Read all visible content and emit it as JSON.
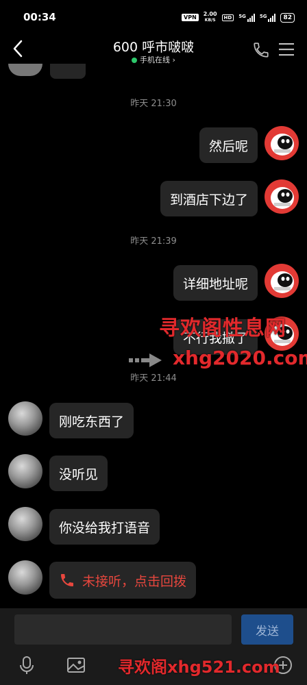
{
  "status_bar": {
    "time": "00:34",
    "vpn": "VPN",
    "speed_value": "2.00",
    "speed_unit": "KB/S",
    "hd": "HD",
    "signal1": "5G",
    "signal2": "5G",
    "battery": "82"
  },
  "header": {
    "contact_name": "600 呼市啵啵",
    "online_status": "手机在线",
    "online_arrow": "›"
  },
  "messages": [
    {
      "type": "time",
      "text": "昨天 21:30"
    },
    {
      "type": "sent",
      "text": "然后呢"
    },
    {
      "type": "sent",
      "text": "到酒店下边了"
    },
    {
      "type": "time",
      "text": "昨天 21:39"
    },
    {
      "type": "sent",
      "text": "详细地址呢"
    },
    {
      "type": "sent",
      "text": "不行我撤了"
    },
    {
      "type": "time",
      "text": "昨天 21:44"
    },
    {
      "type": "received",
      "text": "刚吃东西了"
    },
    {
      "type": "received",
      "text": "没听见"
    },
    {
      "type": "received",
      "text": "你没给我打语音"
    },
    {
      "type": "received_call",
      "text": "未接听，点击回拨"
    }
  ],
  "watermarks": {
    "mid_title": "寻欢阁性息网",
    "mid_url": "xhg2020.com",
    "bottom": "寻欢阁xhg521.com"
  },
  "input_bar": {
    "placeholder": "",
    "send_label": "发送"
  },
  "colors": {
    "background": "#000000",
    "bubble": "#262626",
    "online_dot": "#2dc86b",
    "missed_call": "#e8473e",
    "send_button": "#1e4e8c",
    "robot_avatar": "#e23a35",
    "watermark": "#e2292c"
  },
  "icons": {
    "back": "chevron-left-icon",
    "phone": "phone-icon",
    "menu": "menu-icon",
    "voice": "microphone-icon",
    "image": "image-icon",
    "plus": "plus-circle-icon",
    "missed_call": "phone-missed-icon"
  }
}
